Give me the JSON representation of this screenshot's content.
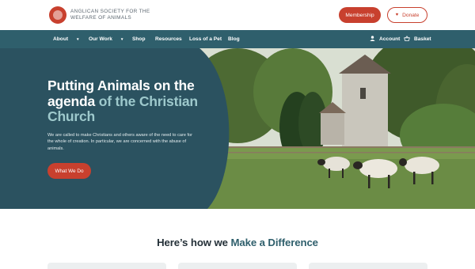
{
  "header": {
    "logo_text": "Anglican Society for the Welfare of Animals",
    "membership_label": "Membership",
    "donate_label": "Donate"
  },
  "nav": {
    "items": [
      {
        "label": "About",
        "has_dropdown": true
      },
      {
        "label": "Our Work",
        "has_dropdown": true
      },
      {
        "label": "Shop"
      },
      {
        "label": "Resources"
      },
      {
        "label": "Loss of a Pet"
      },
      {
        "label": "Blog"
      }
    ],
    "account_label": "Account",
    "basket_label": "Basket"
  },
  "hero": {
    "title_main": "Putting Animals on the agenda",
    "title_accent": "of the Christian Church",
    "body": "We are called to make Christians and others aware of the need to care for the whole of creation. In particular, we are concerned with the abuse of animals.",
    "cta_label": "What We Do"
  },
  "section": {
    "title_prefix": "Here’s how we",
    "title_accent": "Make a Difference"
  },
  "colors": {
    "brand_red": "#c8402e",
    "nav_teal": "#2f5f6c",
    "panel_teal": "#2b5260",
    "accent_teal": "#9ec9cc"
  }
}
